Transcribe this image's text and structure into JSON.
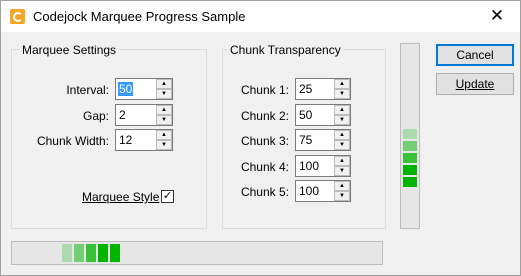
{
  "window": {
    "title": "Codejock Marquee Progress Sample",
    "close_glyph": "✕"
  },
  "marquee_settings": {
    "group_label": "Marquee Settings",
    "interval": {
      "label": "Interval:",
      "value": "50"
    },
    "gap": {
      "label": "Gap:",
      "value": "2"
    },
    "chunk_width": {
      "label": "Chunk Width:",
      "value": "12"
    },
    "marquee_style": {
      "label": "Marquee Style",
      "checked": true,
      "check_glyph": "✓"
    }
  },
  "chunk_transparency": {
    "group_label": "Chunk Transparency",
    "chunks": [
      {
        "label": "Chunk 1:",
        "value": "25"
      },
      {
        "label": "Chunk 2:",
        "value": "50"
      },
      {
        "label": "Chunk 3:",
        "value": "75"
      },
      {
        "label": "Chunk 4:",
        "value": "100"
      },
      {
        "label": "Chunk 5:",
        "value": "100"
      }
    ]
  },
  "spin": {
    "up_glyph": "▲",
    "down_glyph": "▼"
  },
  "buttons": {
    "cancel": "Cancel",
    "update": "Update"
  },
  "colors": {
    "chunk_base": "#00b400",
    "progress_track": "#e6e6e6"
  }
}
